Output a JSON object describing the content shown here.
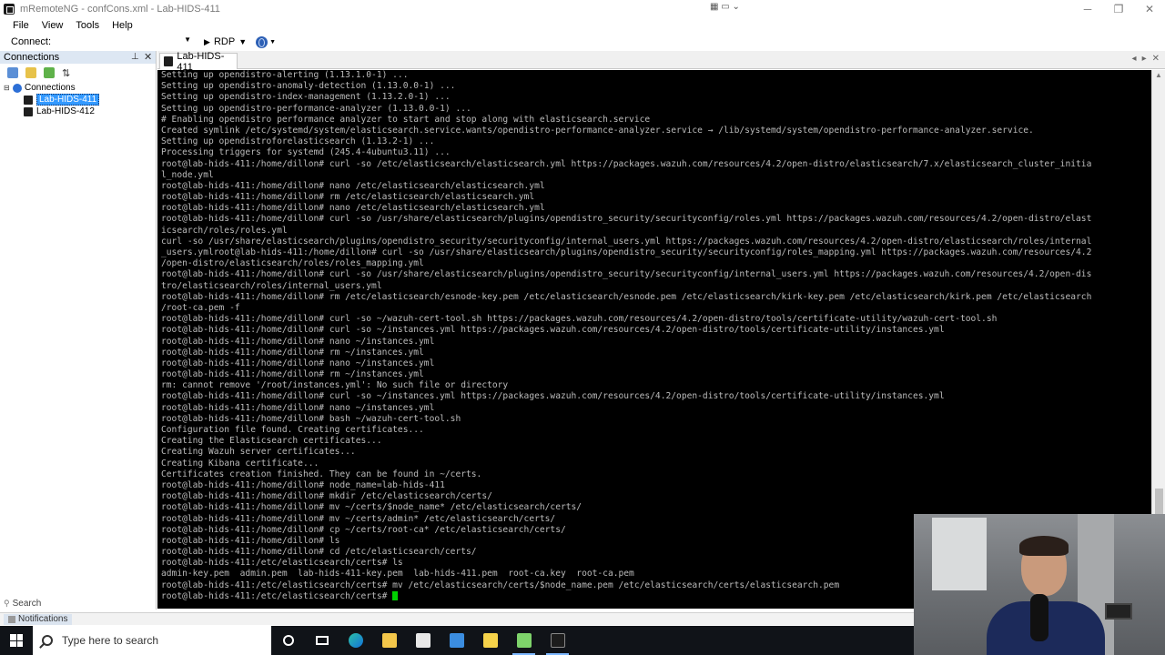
{
  "window": {
    "title": "mRemoteNG - confCons.xml - Lab-HIDS-411",
    "quick_icons": "▦ ▭ ⌄",
    "minimize": "─",
    "maximize": "❐",
    "close": "✕"
  },
  "menu": {
    "items": [
      "File",
      "View",
      "Tools",
      "Help"
    ]
  },
  "toolbar": {
    "connect_label": "Connect:",
    "connect_value": "",
    "protocol": "RDP"
  },
  "connections_panel": {
    "title": "Connections",
    "root_label": "Connections",
    "items": [
      {
        "label": "Lab-HIDS-411",
        "selected": true
      },
      {
        "label": "Lab-HIDS-412",
        "selected": false
      }
    ],
    "search_label": "Search"
  },
  "notifications": {
    "label": "Notifications"
  },
  "tabs": {
    "active_tab": "Lab-HIDS-411"
  },
  "terminal": {
    "lines": [
      "Setting up opendistro-alerting (1.13.1.0-1) ...",
      "Setting up opendistro-anomaly-detection (1.13.0.0-1) ...",
      "Setting up opendistro-index-management (1.13.2.0-1) ...",
      "Setting up opendistro-performance-analyzer (1.13.0.0-1) ...",
      "# Enabling opendistro performance analyzer to start and stop along with elasticsearch.service",
      "Created symlink /etc/systemd/system/elasticsearch.service.wants/opendistro-performance-analyzer.service → /lib/systemd/system/opendistro-performance-analyzer.service.",
      "Setting up opendistroforelasticsearch (1.13.2-1) ...",
      "Processing triggers for systemd (245.4-4ubuntu3.11) ...",
      "root@lab-hids-411:/home/dillon# curl -so /etc/elasticsearch/elasticsearch.yml https://packages.wazuh.com/resources/4.2/open-distro/elasticsearch/7.x/elasticsearch_cluster_initia",
      "l_node.yml",
      "root@lab-hids-411:/home/dillon# nano /etc/elasticsearch/elasticsearch.yml",
      "root@lab-hids-411:/home/dillon# rm /etc/elasticsearch/elasticsearch.yml",
      "root@lab-hids-411:/home/dillon# nano /etc/elasticsearch/elasticsearch.yml",
      "root@lab-hids-411:/home/dillon# curl -so /usr/share/elasticsearch/plugins/opendistro_security/securityconfig/roles.yml https://packages.wazuh.com/resources/4.2/open-distro/elast",
      "icsearch/roles/roles.yml",
      "curl -so /usr/share/elasticsearch/plugins/opendistro_security/securityconfig/internal_users.yml https://packages.wazuh.com/resources/4.2/open-distro/elasticsearch/roles/internal",
      "_users.ymlroot@lab-hids-411:/home/dillon# curl -so /usr/share/elasticsearch/plugins/opendistro_security/securityconfig/roles_mapping.yml https://packages.wazuh.com/resources/4.2",
      "/open-distro/elasticsearch/roles/roles_mapping.yml",
      "root@lab-hids-411:/home/dillon# curl -so /usr/share/elasticsearch/plugins/opendistro_security/securityconfig/internal_users.yml https://packages.wazuh.com/resources/4.2/open-dis",
      "tro/elasticsearch/roles/internal_users.yml",
      "root@lab-hids-411:/home/dillon# rm /etc/elasticsearch/esnode-key.pem /etc/elasticsearch/esnode.pem /etc/elasticsearch/kirk-key.pem /etc/elasticsearch/kirk.pem /etc/elasticsearch",
      "/root-ca.pem -f",
      "root@lab-hids-411:/home/dillon# curl -so ~/wazuh-cert-tool.sh https://packages.wazuh.com/resources/4.2/open-distro/tools/certificate-utility/wazuh-cert-tool.sh",
      "root@lab-hids-411:/home/dillon# curl -so ~/instances.yml https://packages.wazuh.com/resources/4.2/open-distro/tools/certificate-utility/instances.yml",
      "root@lab-hids-411:/home/dillon# nano ~/instances.yml",
      "root@lab-hids-411:/home/dillon# rm ~/instances.yml",
      "root@lab-hids-411:/home/dillon# nano ~/instances.yml",
      "root@lab-hids-411:/home/dillon# rm ~/instances.yml",
      "rm: cannot remove '/root/instances.yml': No such file or directory",
      "root@lab-hids-411:/home/dillon# curl -so ~/instances.yml https://packages.wazuh.com/resources/4.2/open-distro/tools/certificate-utility/instances.yml",
      "root@lab-hids-411:/home/dillon# nano ~/instances.yml",
      "root@lab-hids-411:/home/dillon# bash ~/wazuh-cert-tool.sh",
      "Configuration file found. Creating certificates...",
      "Creating the Elasticsearch certificates...",
      "Creating Wazuh server certificates...",
      "Creating Kibana certificate...",
      "Certificates creation finished. They can be found in ~/certs.",
      "root@lab-hids-411:/home/dillon# node_name=lab-hids-411",
      "root@lab-hids-411:/home/dillon# mkdir /etc/elasticsearch/certs/",
      "root@lab-hids-411:/home/dillon# mv ~/certs/$node_name* /etc/elasticsearch/certs/",
      "root@lab-hids-411:/home/dillon# mv ~/certs/admin* /etc/elasticsearch/certs/",
      "root@lab-hids-411:/home/dillon# cp ~/certs/root-ca* /etc/elasticsearch/certs/",
      "root@lab-hids-411:/home/dillon# ls",
      "root@lab-hids-411:/home/dillon# cd /etc/elasticsearch/certs/",
      "root@lab-hids-411:/etc/elasticsearch/certs# ls",
      "admin-key.pem  admin.pem  lab-hids-411-key.pem  lab-hids-411.pem  root-ca.key  root-ca.pem",
      "root@lab-hids-411:/etc/elasticsearch/certs# mv /etc/elasticsearch/certs/$node_name.pem /etc/elasticsearch/certs/elasticsearch.pem",
      "root@lab-hids-411:/etc/elasticsearch/certs# "
    ],
    "text_color": "#bbbbbb",
    "cursor_color": "#00d000"
  },
  "taskbar": {
    "search_placeholder": "Type here to search"
  }
}
